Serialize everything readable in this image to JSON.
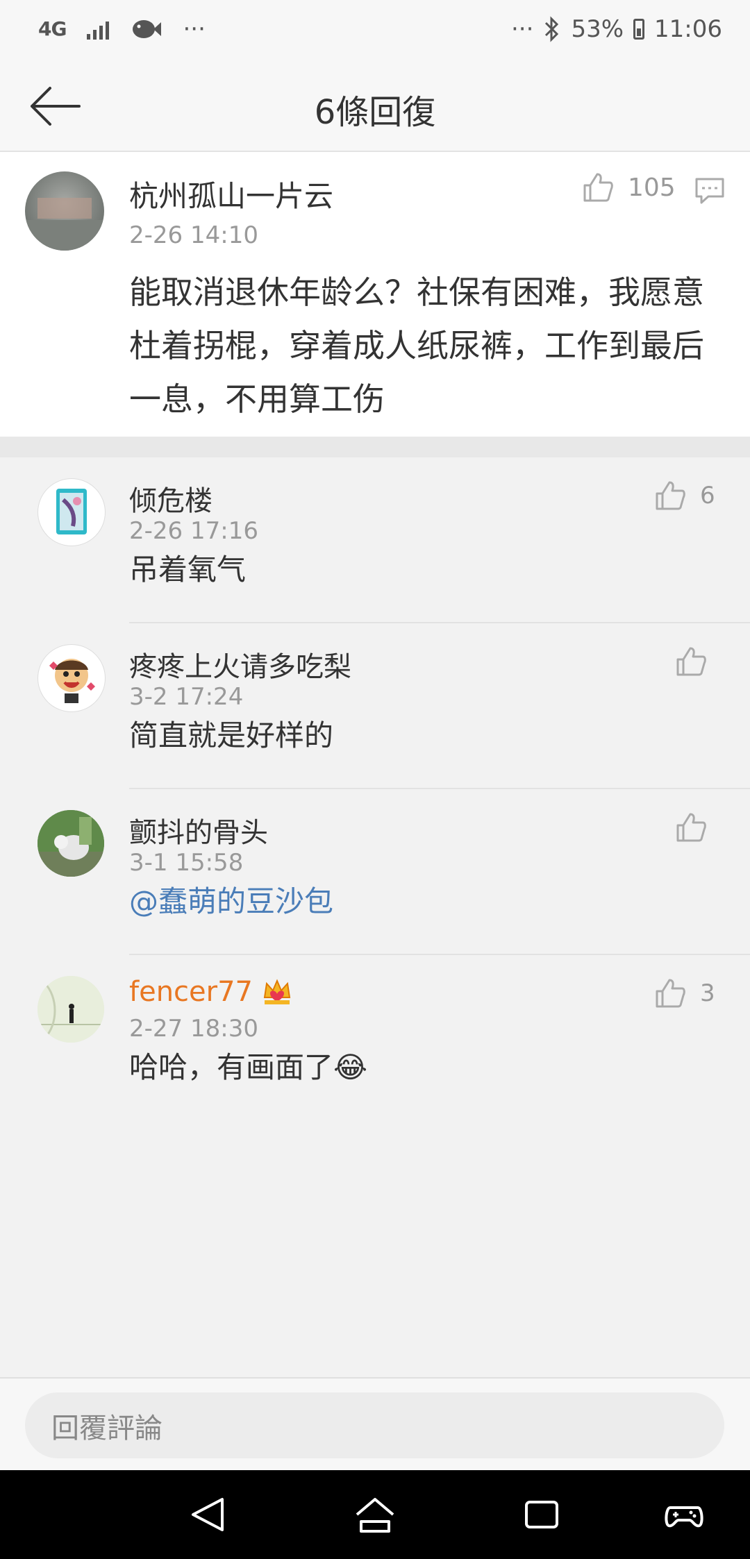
{
  "status_bar": {
    "network": "4G",
    "more_left": "···",
    "more_right": "···",
    "battery": "53%",
    "time": "11:06"
  },
  "header": {
    "title": "6條回復"
  },
  "main_comment": {
    "author": "杭州孤山一片云",
    "time": "2-26 14:10",
    "likes": "105",
    "text": "能取消退休年龄么？社保有困难，我愿意杜着拐棍，穿着成人纸尿裤，工作到最后一息，不用算工伤"
  },
  "replies": [
    {
      "author": "倾危楼",
      "time": "2-26 17:16",
      "likes": "6",
      "text": "吊着氧气"
    },
    {
      "author": "疼疼上火请多吃梨",
      "time": "3-2 17:24",
      "likes": "",
      "text": "简直就是好样的"
    },
    {
      "author": "颤抖的骨头",
      "time": "3-1 15:58",
      "likes": "",
      "text": "@蠢萌的豆沙包"
    },
    {
      "author": "fencer77",
      "time": "2-27 18:30",
      "likes": "3",
      "text": "哈哈，有画面了😂"
    }
  ],
  "colors": {
    "accent_link": "#4a7db8",
    "vip_name": "#e87722",
    "muted": "#999999"
  },
  "input": {
    "placeholder": "回覆評論"
  }
}
